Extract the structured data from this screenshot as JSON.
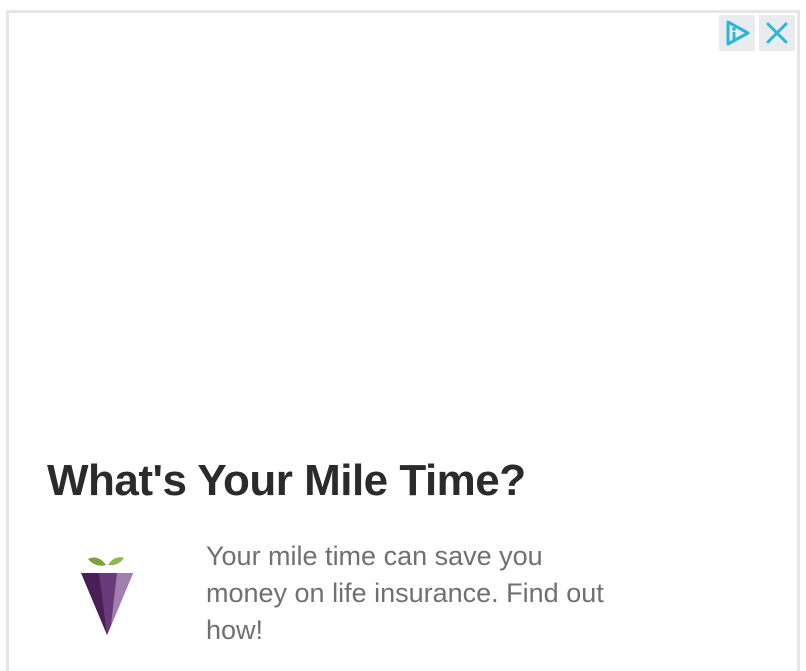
{
  "ad": {
    "headline": "What's Your Mile Time?",
    "description": "Your mile time can save you money on life insurance. Find out how!",
    "icons": {
      "adchoices": "adchoices-icon",
      "close": "close-icon",
      "logo": "brand-logo"
    }
  },
  "colors": {
    "accent": "#2bb6d6",
    "headline": "#2b2b2b",
    "body_text": "#707070",
    "logo_purple": "#4a1f57",
    "logo_leaf": "#7aa33a"
  }
}
